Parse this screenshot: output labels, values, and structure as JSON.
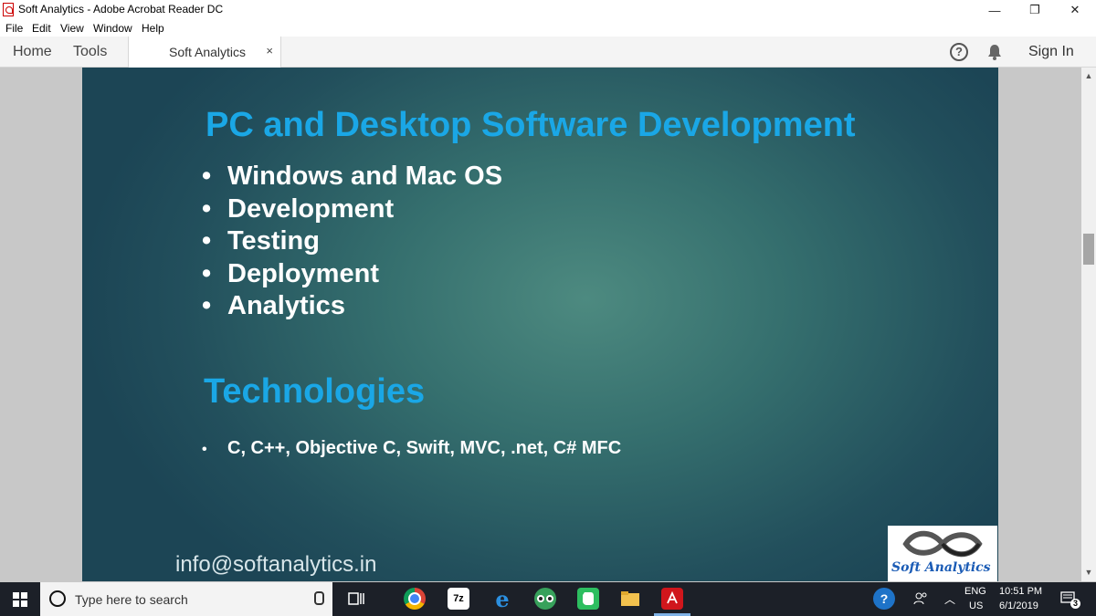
{
  "window": {
    "title": "Soft Analytics - Adobe Acrobat Reader DC",
    "minimize_glyph": "—",
    "maximize_glyph": "❐",
    "close_glyph": "✕"
  },
  "menu": [
    "File",
    "Edit",
    "View",
    "Window",
    "Help"
  ],
  "nav": {
    "home": "Home",
    "tools": "Tools",
    "doc_tab": "Soft Analytics",
    "close_glyph": "×",
    "help_glyph": "?",
    "sign_in": "Sign In"
  },
  "slide": {
    "title": "PC and Desktop Software Development",
    "bullet_glyph": "•",
    "bullets": [
      "Windows and Mac OS",
      "Development",
      "Testing",
      "Deployment",
      "Analytics"
    ],
    "tech_title": "Technologies",
    "tech_line": "C, C++, Objective C, Swift, MVC, .net, C# MFC",
    "email": "info@softanalytics.in",
    "logo_text": "Soft Analytics"
  },
  "taskbar": {
    "search_placeholder": "Type here to search",
    "language": "ENG",
    "region": "US",
    "time": "10:51 PM",
    "date": "6/1/2019",
    "notification_count": "3",
    "apps": [
      {
        "name": "task-view-icon"
      },
      {
        "name": "chrome-icon"
      },
      {
        "name": "7zip-icon",
        "label": "7z"
      },
      {
        "name": "edge-icon",
        "label": "e"
      },
      {
        "name": "tripadvisor-icon"
      },
      {
        "name": "evernote-icon"
      },
      {
        "name": "file-explorer-icon"
      },
      {
        "name": "acrobat-icon"
      }
    ]
  },
  "colors": {
    "heading": "#1aa7e6",
    "slide_center": "#4d8a80",
    "slide_edge": "#1c4555",
    "taskbar": "#1c2028"
  }
}
